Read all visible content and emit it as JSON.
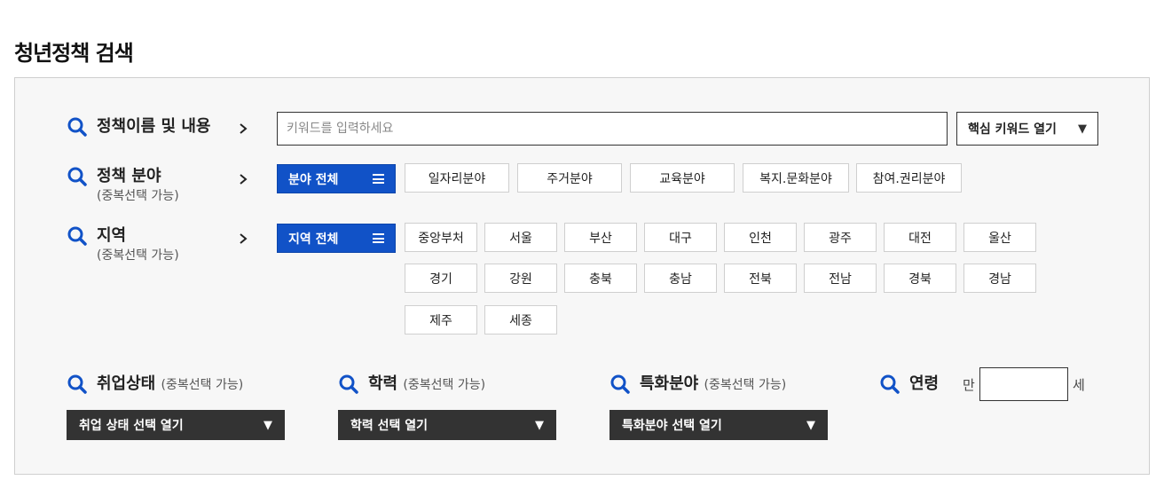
{
  "page_title": "청년정책 검색",
  "keyword": {
    "label": "정책이름 및 내용",
    "input_placeholder": "키워드를 입력하세요",
    "input_value": "",
    "toggle_label": "핵심 키워드 열기"
  },
  "field": {
    "label": "정책 분야",
    "sub": "(중복선택 가능)",
    "all_label": "분야 전체",
    "options": [
      "일자리분야",
      "주거분야",
      "교육분야",
      "복지.문화분야",
      "참여.권리분야"
    ]
  },
  "region": {
    "label": "지역",
    "sub": "(중복선택 가능)",
    "all_label": "지역 전체",
    "options": [
      "중앙부처",
      "서울",
      "부산",
      "대구",
      "인천",
      "광주",
      "대전",
      "울산",
      "경기",
      "강원",
      "충북",
      "충남",
      "전북",
      "전남",
      "경북",
      "경남",
      "제주",
      "세종"
    ]
  },
  "employment": {
    "label": "취업상태",
    "sub": "(중복선택 가능)",
    "select_label": "취업 상태 선택 열기"
  },
  "education": {
    "label": "학력",
    "sub": "(중복선택 가능)",
    "select_label": "학력 선택 열기"
  },
  "special": {
    "label": "특화분야",
    "sub": "(중복선택 가능)",
    "select_label": "특화분야 선택 열기"
  },
  "age": {
    "label": "연령",
    "prefix": "만",
    "suffix": "세",
    "value": ""
  },
  "colors": {
    "accent": "#1152c7",
    "dark": "#333333",
    "panel_bg": "#f7f7f7"
  },
  "icons": {
    "search": "search-icon",
    "chevron": "chevron-right-icon",
    "menu": "menu-icon",
    "dropdown": "triangle-down-icon"
  }
}
